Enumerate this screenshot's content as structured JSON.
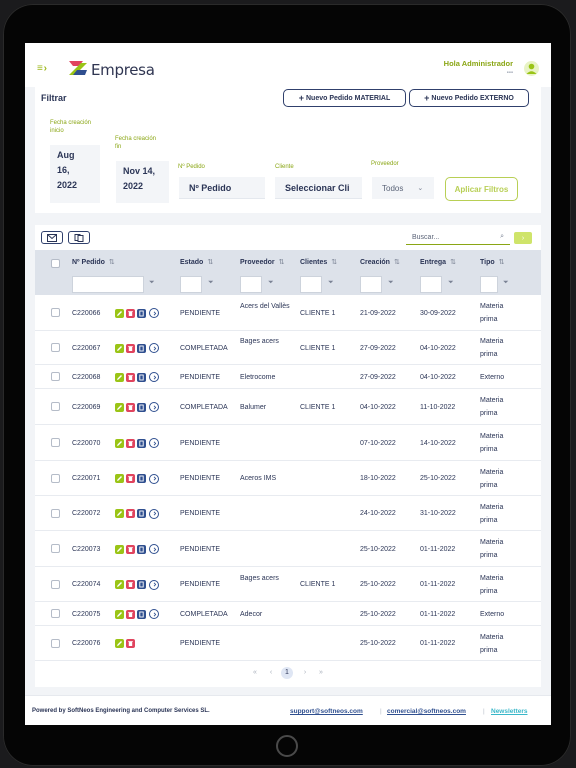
{
  "header": {
    "brand": "Empresa",
    "greeting": "Hola Administrador",
    "greeting_sub": "▪▪▪",
    "accent_color": "#8aa614",
    "menu_icon": "menu-toggle-icon"
  },
  "filters": {
    "title": "Filtrar",
    "new_material_label": "Nuevo Pedido MATERIAL",
    "new_external_label": "Nuevo Pedido EXTERNO",
    "start_date_label_1": "Fecha creación",
    "start_date_label_2": "inicio",
    "start_date": [
      "Aug",
      "16,",
      "2022"
    ],
    "end_date_label_1": "Fecha creación",
    "end_date_label_2": "fin",
    "end_date": [
      "Nov 14,",
      "2022"
    ],
    "order_no_label": "Nº Pedido",
    "order_no_value": "Nº Pedido",
    "client_label": "Cliente",
    "client_value": "Seleccionar Cli",
    "supplier_label": "Proveedor",
    "supplier_value": "Todos",
    "apply_label": "Aplicar Filtros"
  },
  "toolbar": {
    "search_placeholder": "Buscar...",
    "email_icon": "email-icon",
    "copy_icon": "copy-icon"
  },
  "table": {
    "headers": {
      "order": "Nº Pedido",
      "status": "Estado",
      "supplier": "Proveedor",
      "clients": "Clientes",
      "created": "Creación",
      "delivery": "Entrega",
      "type": "Tipo"
    },
    "rows": [
      {
        "id": "C220066",
        "status": "PENDIENTE",
        "supplier": "Acers del Vallès",
        "client": "CLIENTE 1",
        "created": "21-09-2022",
        "delivery": "30-09-2022",
        "type": "Materia prima"
      },
      {
        "id": "C220067",
        "status": "COMPLETADA",
        "supplier": "Bages acers",
        "client": "CLIENTE 1",
        "created": "27-09-2022",
        "delivery": "04-10-2022",
        "type": "Materia prima"
      },
      {
        "id": "C220068",
        "status": "PENDIENTE",
        "supplier": "Eletrocome",
        "client": "",
        "created": "27-09-2022",
        "delivery": "04-10-2022",
        "type": "Externo"
      },
      {
        "id": "C220069",
        "status": "COMPLETADA",
        "supplier": "Balumer",
        "client": "CLIENTE 1",
        "created": "04-10-2022",
        "delivery": "11-10-2022",
        "type": "Materia prima"
      },
      {
        "id": "C220070",
        "status": "PENDIENTE",
        "supplier": "",
        "client": "",
        "created": "07-10-2022",
        "delivery": "14-10-2022",
        "type": "Materia prima"
      },
      {
        "id": "C220071",
        "status": "PENDIENTE",
        "supplier": "Aceros IMS",
        "client": "",
        "created": "18-10-2022",
        "delivery": "25-10-2022",
        "type": "Materia prima"
      },
      {
        "id": "C220072",
        "status": "PENDIENTE",
        "supplier": "",
        "client": "",
        "created": "24-10-2022",
        "delivery": "31-10-2022",
        "type": "Materia prima"
      },
      {
        "id": "C220073",
        "status": "PENDIENTE",
        "supplier": "",
        "client": "",
        "created": "25-10-2022",
        "delivery": "01-11-2022",
        "type": "Materia prima"
      },
      {
        "id": "C220074",
        "status": "PENDIENTE",
        "supplier": "Bages acers",
        "client": "CLIENTE 1",
        "created": "25-10-2022",
        "delivery": "01-11-2022",
        "type": "Materia prima"
      },
      {
        "id": "C220075",
        "status": "COMPLETADA",
        "supplier": "Adecor",
        "client": "",
        "created": "25-10-2022",
        "delivery": "01-11-2022",
        "type": "Externo"
      },
      {
        "id": "C220076",
        "status": "PENDIENTE",
        "supplier": "",
        "client": "",
        "created": "25-10-2022",
        "delivery": "01-11-2022",
        "type": "Materia prima"
      }
    ]
  },
  "pagination": {
    "first": "«",
    "prev": "‹",
    "current": "1",
    "next": "›",
    "last": "»"
  },
  "footer": {
    "powered_by": "Powered by SoftNeos Engineering and Computer Services SL.",
    "support_email": "support@softneos.com",
    "commercial_email": "comercial@softneos.com",
    "newsletter": "Newsletters",
    "separator": "|"
  }
}
